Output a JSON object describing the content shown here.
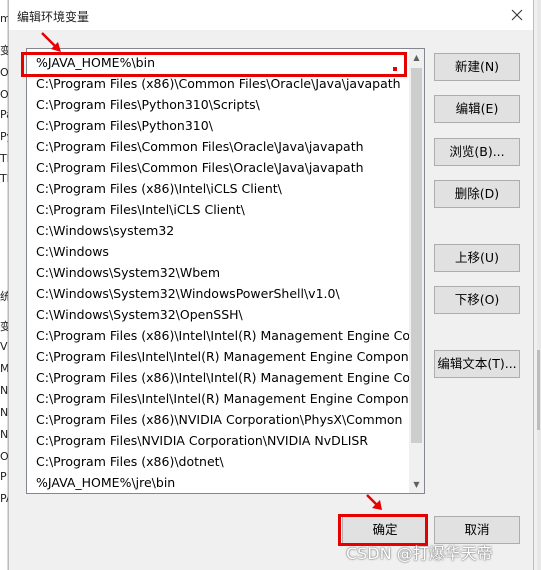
{
  "dialog": {
    "title": "编辑环境变量"
  },
  "path_list": [
    "%JAVA_HOME%\\bin",
    "C:\\Program Files (x86)\\Common Files\\Oracle\\Java\\javapath",
    "C:\\Program Files\\Python310\\Scripts\\",
    "C:\\Program Files\\Python310\\",
    "C:\\Program Files\\Common Files\\Oracle\\Java\\javapath",
    "C:\\Program Files\\Common Files\\Oracle\\Java\\javapath",
    "C:\\Program Files (x86)\\Intel\\iCLS Client\\",
    "C:\\Program Files\\Intel\\iCLS Client\\",
    "C:\\Windows\\system32",
    "C:\\Windows",
    "C:\\Windows\\System32\\Wbem",
    "C:\\Windows\\System32\\WindowsPowerShell\\v1.0\\",
    "C:\\Windows\\System32\\OpenSSH\\",
    "C:\\Program Files (x86)\\Intel\\Intel(R) Management Engine Co...",
    "C:\\Program Files\\Intel\\Intel(R) Management Engine Compon...",
    "C:\\Program Files (x86)\\Intel\\Intel(R) Management Engine Co...",
    "C:\\Program Files\\Intel\\Intel(R) Management Engine Compon...",
    "C:\\Program Files (x86)\\NVIDIA Corporation\\PhysX\\Common",
    "C:\\Program Files\\NVIDIA Corporation\\NVIDIA NvDLISR",
    "C:\\Program Files (x86)\\dotnet\\",
    "%JAVA_HOME%\\jre\\bin"
  ],
  "buttons": {
    "new": "新建(N)",
    "edit": "编辑(E)",
    "browse": "浏览(B)...",
    "delete": "删除(D)",
    "move_up": "上移(U)",
    "move_down": "下移(O)",
    "edit_text": "编辑文本(T)...",
    "ok": "确定",
    "cancel": "取消"
  },
  "background_window_chars": [
    "m",
    "变",
    "O",
    "O",
    "Pa",
    "Py",
    "TE",
    "TM",
    "统",
    "变",
    "Vi",
    "M",
    "N",
    "N",
    "N",
    "O",
    "P",
    "PA"
  ],
  "watermark": "CSDN @打爆华天帝",
  "colors": {
    "highlight_red": "#e60000",
    "button_face": "#e1e1e1",
    "dialog_bg": "#f0f0f0"
  },
  "icons": {
    "close": "close-icon",
    "annotation_arrow": "arrow-annotation-icon",
    "scroll_up": "scroll-up-icon",
    "scroll_down": "scroll-down-icon"
  }
}
